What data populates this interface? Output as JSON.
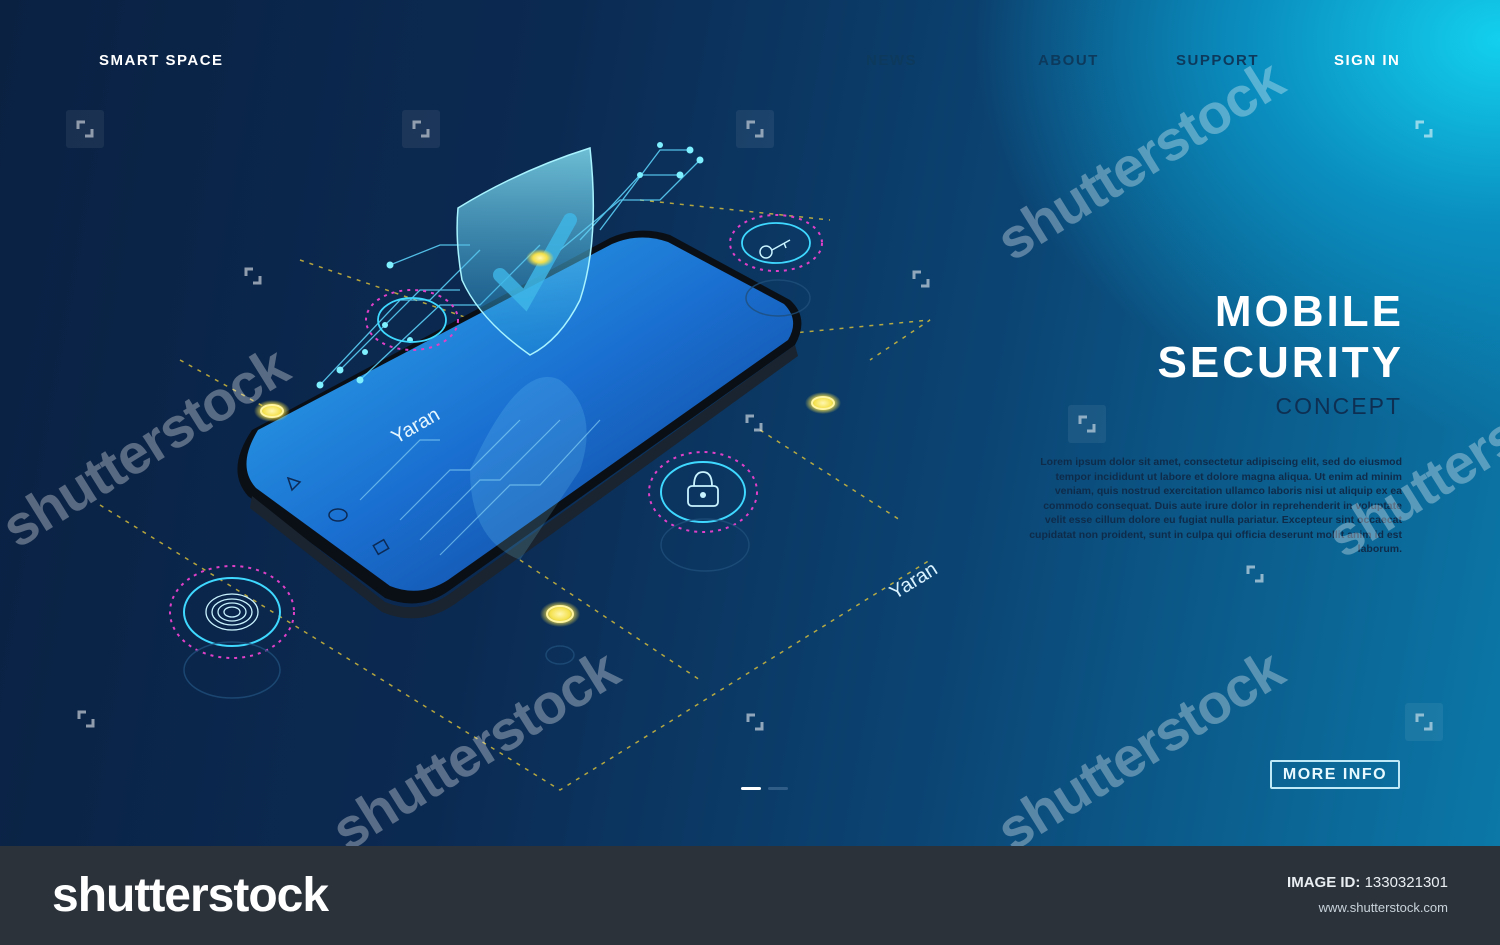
{
  "nav": {
    "brand": "SMART SPACE",
    "items": [
      "NEWS",
      "ABOUT",
      "SUPPORT",
      "SIGN IN"
    ]
  },
  "hero": {
    "title_line1": "MOBILE",
    "title_line2": "SECURITY",
    "subtitle": "CONCEPT",
    "body": "Lorem ipsum dolor sit amet, consectetur adipiscing elit, sed do eiusmod tempor incididunt ut labore et dolore magna aliqua. Ut enim ad minim veniam, quis nostrud exercitation ullamco laboris nisi ut aliquip ex ea commodo consequat. Duis aute irure dolor in reprehenderit in voluptate velit esse cillum dolore eu fugiat nulla pariatur. Excepteur sint occaecat cupidatat non proident, sunt in culpa qui officia deserunt mollit anim id est laborum.",
    "cta": "MORE INFO",
    "signature": "Yaran"
  },
  "watermark": {
    "text": "shutterstock",
    "icon": "shutterstock-logo-icon"
  },
  "footer": {
    "logo": "shutterstock",
    "image_id_label": "IMAGE ID:",
    "image_id": "1330321301",
    "url": "www.shutterstock.com"
  },
  "colors": {
    "accent_cyan": "#2fd6ff",
    "accent_pink": "#e040c8",
    "accent_yellow": "#f4e04a",
    "dark_bg": "#0a2142"
  }
}
